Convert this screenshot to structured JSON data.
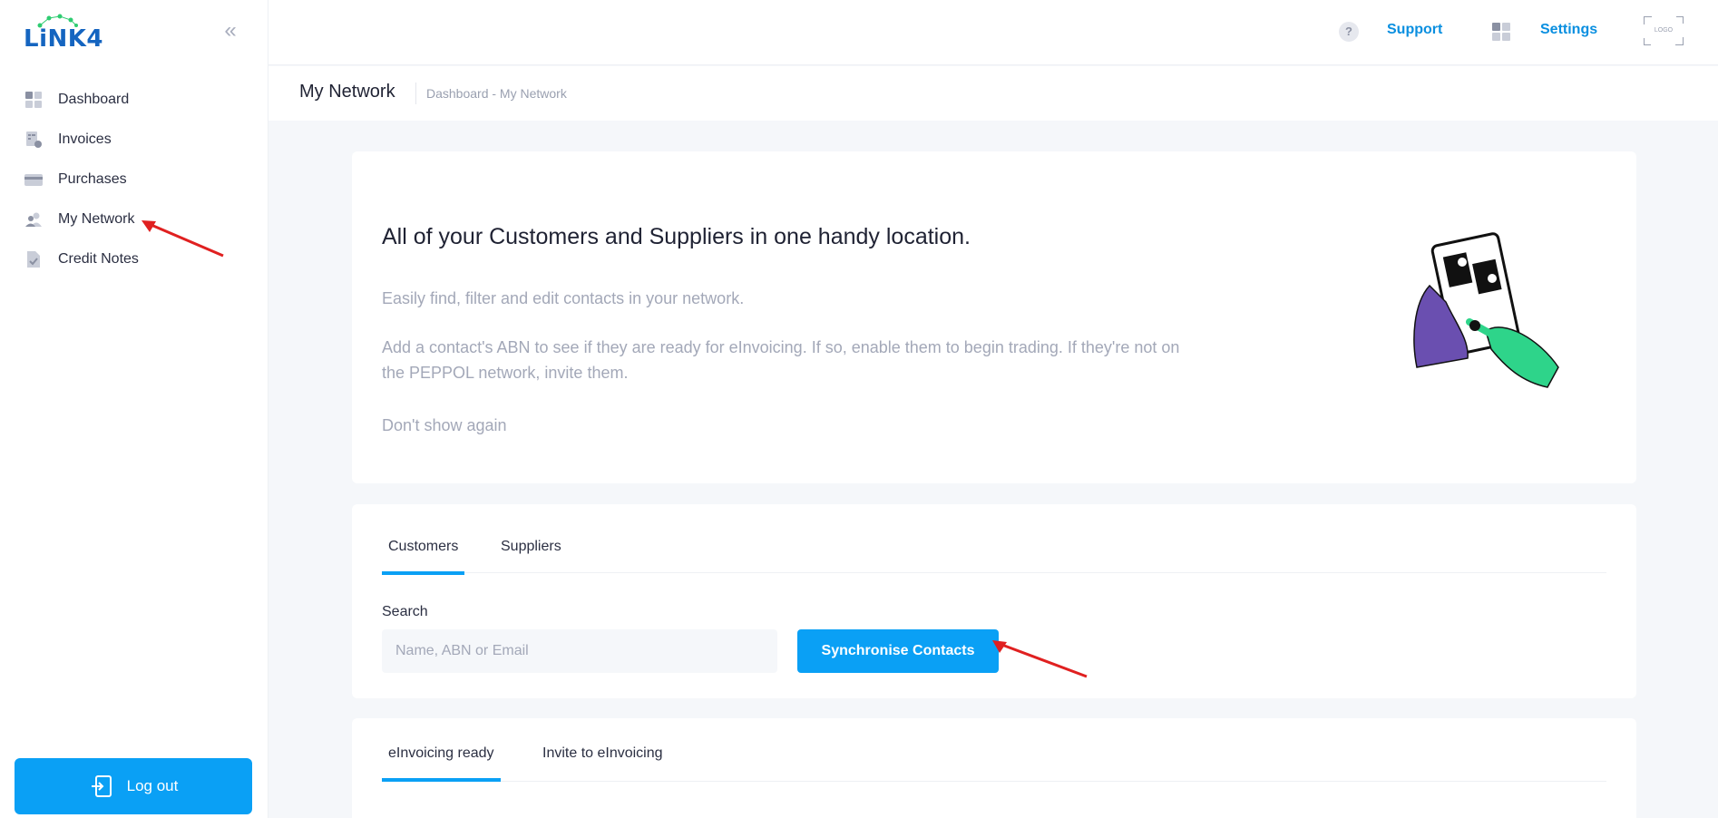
{
  "brand": {
    "logo_text": "LiNK4"
  },
  "sidebar": {
    "collapse_glyph": "«",
    "items": [
      {
        "label": "Dashboard",
        "icon": "dashboard-icon"
      },
      {
        "label": "Invoices",
        "icon": "invoice-icon"
      },
      {
        "label": "Purchases",
        "icon": "card-icon"
      },
      {
        "label": "My Network",
        "icon": "people-icon",
        "active": true
      },
      {
        "label": "Credit Notes",
        "icon": "document-check-icon"
      }
    ],
    "logout_label": "Log out"
  },
  "header": {
    "help_glyph": "?",
    "support_label": "Support",
    "settings_label": "Settings",
    "avatar_text": "LOGO"
  },
  "page": {
    "title": "My Network",
    "breadcrumb": "Dashboard - My Network"
  },
  "intro": {
    "heading": "All of your Customers and Suppliers in one handy location.",
    "paragraph1": "Easily find, filter and edit contacts in your network.",
    "paragraph2": "Add a contact's ABN to see if they are ready for eInvoicing. If so, enable them to begin trading. If they're not on the PEPPOL network, invite them.",
    "dont_show": "Don't show again"
  },
  "contacts": {
    "tabs": [
      {
        "label": "Customers",
        "active": true
      },
      {
        "label": "Suppliers",
        "active": false
      }
    ],
    "search_label": "Search",
    "search_placeholder": "Name, ABN or Email",
    "search_value": "",
    "sync_label": "Synchronise Contacts"
  },
  "list": {
    "tabs": [
      {
        "label": "eInvoicing ready",
        "active": true
      },
      {
        "label": "Invite to eInvoicing",
        "active": false
      }
    ]
  },
  "colors": {
    "accent": "#0aa0f5",
    "link": "#0a8fe0",
    "annotation": "#e02020"
  }
}
